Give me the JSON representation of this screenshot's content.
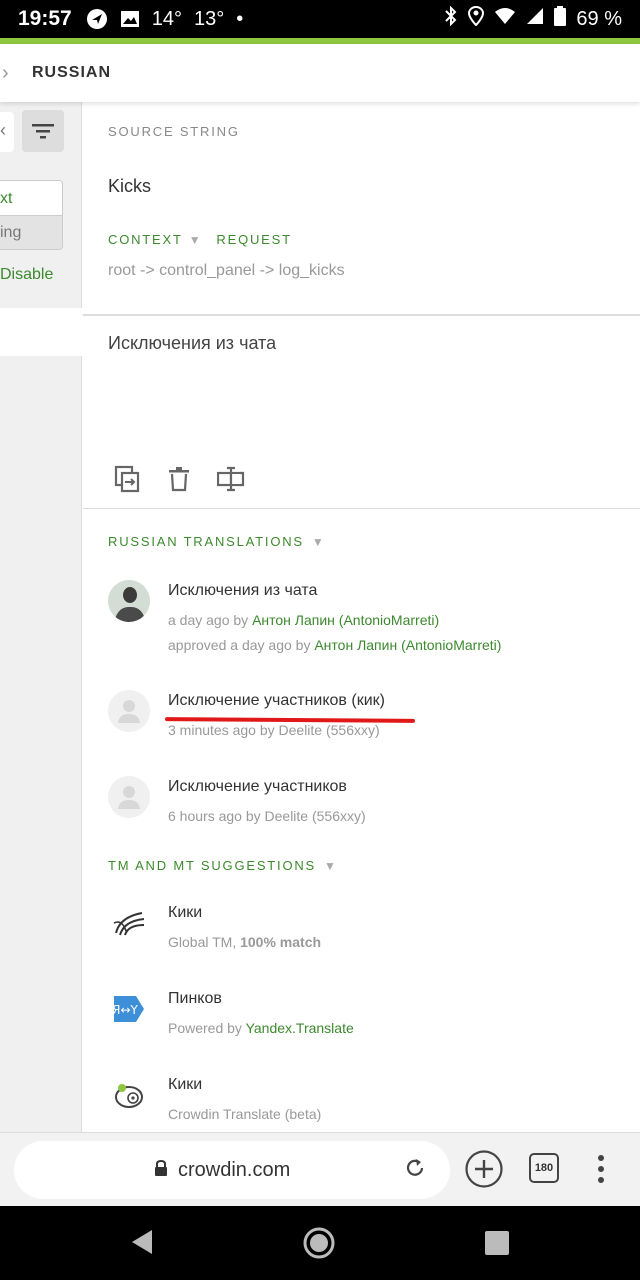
{
  "status": {
    "time": "19:57",
    "temp1": "14°",
    "temp2": "13°",
    "dot": "•",
    "battery": "69 %"
  },
  "header": {
    "title": "RUSSIAN"
  },
  "left": {
    "seg_row1": "xt",
    "seg_row2": "ing",
    "disable": "Disable"
  },
  "source": {
    "label": "SOURCE STRING",
    "text": "Kicks",
    "context_label": "CONTEXT",
    "request_label": "REQUEST",
    "context_path": "root -> control_panel -> log_kicks"
  },
  "translation": {
    "text": "Исключения из чата"
  },
  "russian_translations": {
    "heading": "RUSSIAN TRANSLATIONS",
    "items": [
      {
        "text": "Исключения из чата",
        "time": "a day ago by ",
        "author": "Антон Лапин (AntonioMarreti)",
        "approved_prefix": "approved a day ago by ",
        "approved_author": "Антон Лапин (AntonioMarreti)"
      },
      {
        "text": "Исключение участников (кик)",
        "meta": "3 minutes ago by Deelite (556xxy)"
      },
      {
        "text": "Исключение участников",
        "meta": "6 hours ago by Deelite (556xxy)"
      }
    ]
  },
  "suggestions": {
    "heading": "TM AND MT SUGGESTIONS",
    "items": [
      {
        "text": "Кики",
        "meta_prefix": "Global TM, ",
        "meta_bold": "100% match"
      },
      {
        "text": "Пинков",
        "meta_prefix": "Powered by ",
        "meta_link": "Yandex.Translate"
      },
      {
        "text": "Кики",
        "meta_prefix": "Crowdin Translate (beta)"
      }
    ]
  },
  "browser": {
    "url": "crowdin.com",
    "tab_count": "180"
  },
  "colors": {
    "accent_green": "#3c8a2e",
    "top_green": "#8dc63f",
    "underline_red": "#e01818"
  }
}
